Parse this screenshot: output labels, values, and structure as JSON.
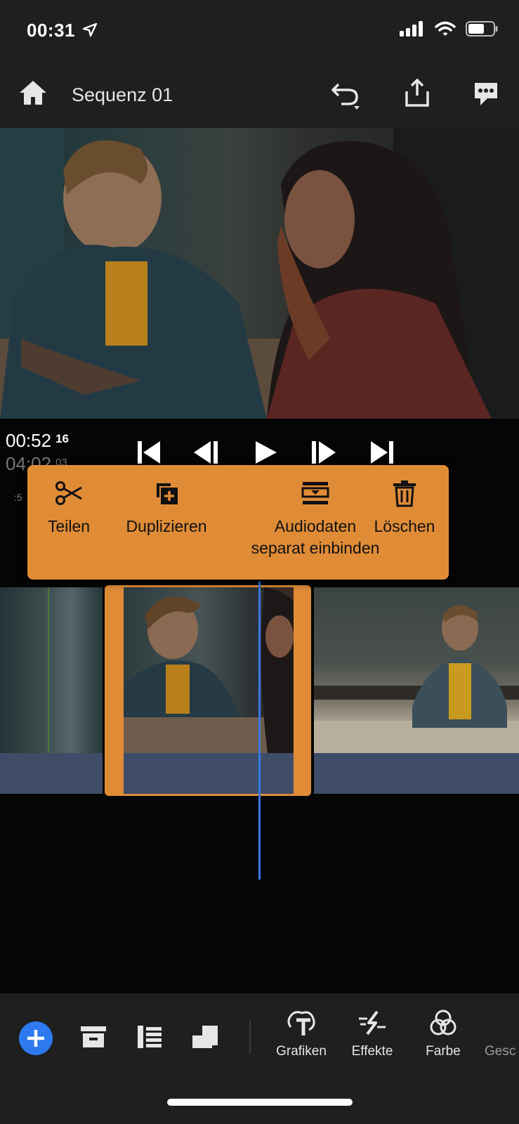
{
  "status": {
    "time": "00:31"
  },
  "header": {
    "title": "Sequenz 01"
  },
  "playback": {
    "current_time": "00:52",
    "current_frames": "16",
    "total_time": "04:02",
    "total_frames": "03",
    "ruler_mark": ":5"
  },
  "context_menu": {
    "split": "Teilen",
    "duplicate": "Duplizieren",
    "detach_audio_line1": "Audiodaten",
    "detach_audio_line2": "separat einbinden",
    "delete": "Löschen"
  },
  "tabs": [
    {
      "label": "Grafiken",
      "icon": "graphics-icon"
    },
    {
      "label": "Effekte",
      "icon": "effects-icon"
    },
    {
      "label": "Farbe",
      "icon": "color-icon"
    },
    {
      "label": "Gesc",
      "icon": "speed-icon"
    }
  ],
  "colors": {
    "accent": "#e08c37",
    "playhead": "#3a78e8",
    "add_button": "#2d7af0",
    "audio_track": "#3e4c67"
  }
}
